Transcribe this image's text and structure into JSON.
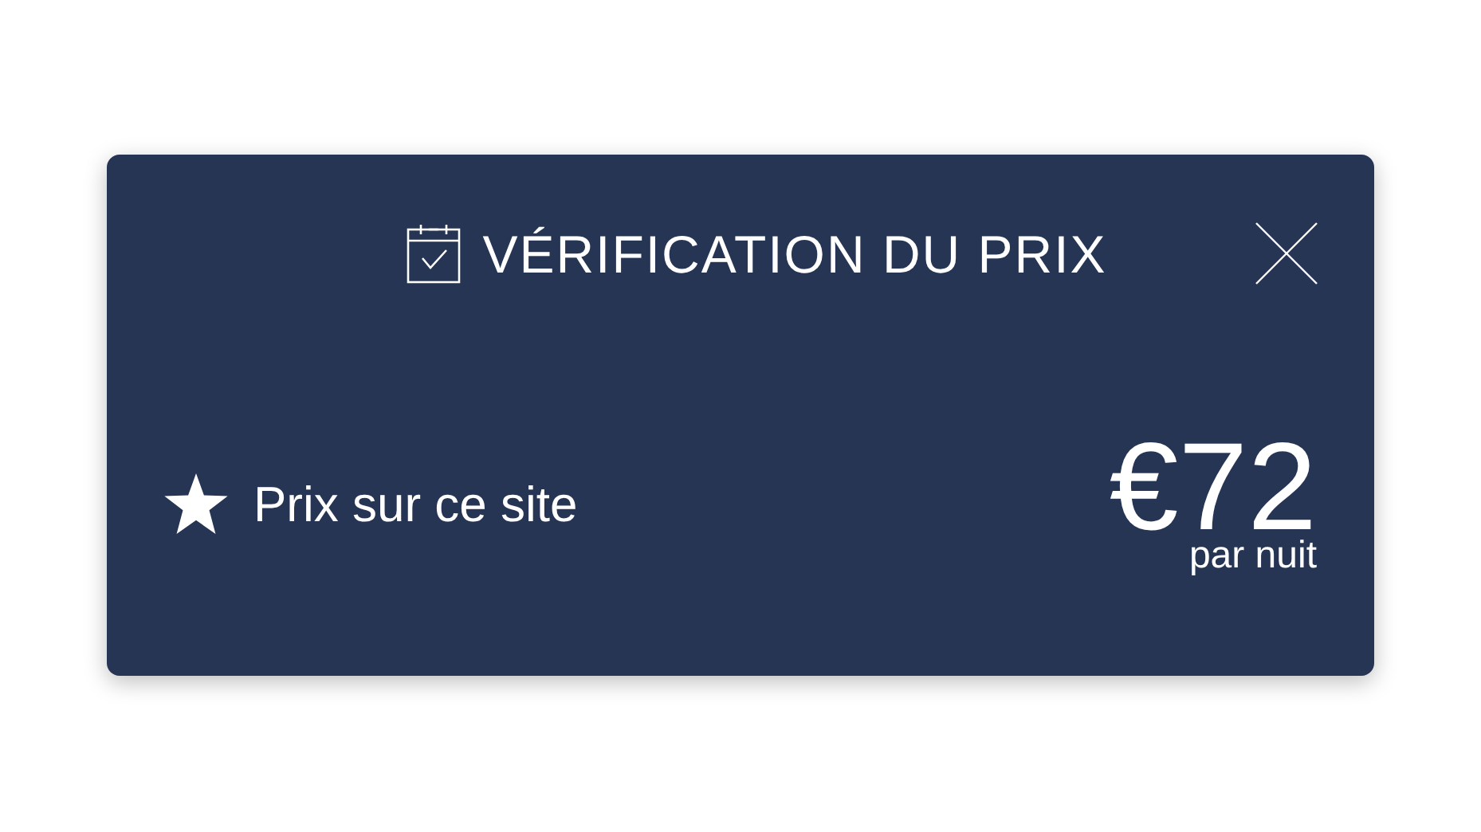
{
  "dialog": {
    "title": "VÉRIFICATION DU PRIX"
  },
  "offer": {
    "label": "Prix sur ce site",
    "price": "€72",
    "unit": "par nuit"
  }
}
